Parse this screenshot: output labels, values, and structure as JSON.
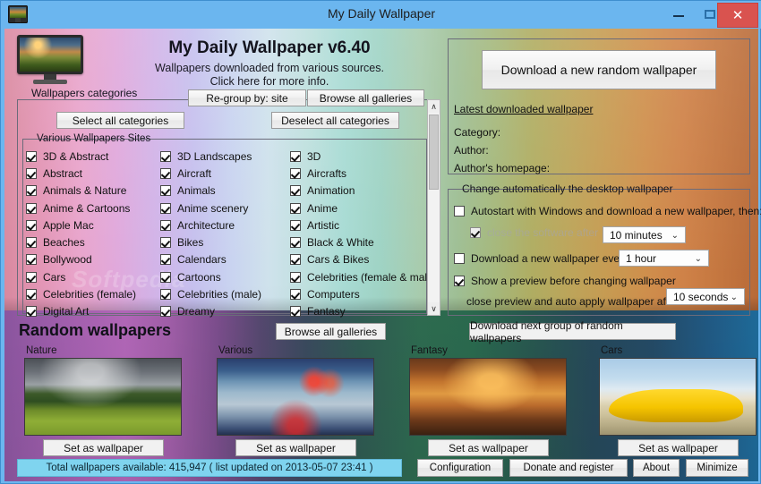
{
  "window": {
    "title": "My Daily Wallpaper",
    "icon": "monitor-icon",
    "minimize_label": "–",
    "maximize_label": "☐",
    "close_label": "✕"
  },
  "header": {
    "app_title": "My Daily Wallpaper v6.40",
    "subtitle_line1": "Wallpapers downloaded from various sources.",
    "subtitle_line2": "Click here for more info.",
    "monitor_icon": "monitor-icon"
  },
  "categories_panel": {
    "group_title": "Wallpapers categories",
    "regroup_button": "Re-group by: site",
    "browse_all_button": "Browse all galleries",
    "select_all_button": "Select all categories",
    "deselect_all_button": "Deselect all categories",
    "sites_group_title": "Various Wallpapers Sites",
    "columns": [
      {
        "items": [
          {
            "label": "3D & Abstract",
            "checked": true
          },
          {
            "label": "Abstract",
            "checked": true
          },
          {
            "label": "Animals & Nature",
            "checked": true
          },
          {
            "label": "Anime & Cartoons",
            "checked": true
          },
          {
            "label": "Apple Mac",
            "checked": true
          },
          {
            "label": "Beaches",
            "checked": true
          },
          {
            "label": "Bollywood",
            "checked": true
          },
          {
            "label": "Cars",
            "checked": true
          },
          {
            "label": "Celebrities (female)",
            "checked": true
          },
          {
            "label": "Digital Art",
            "checked": true
          }
        ]
      },
      {
        "items": [
          {
            "label": "3D Landscapes",
            "checked": true
          },
          {
            "label": "Aircraft",
            "checked": true
          },
          {
            "label": "Animals",
            "checked": true
          },
          {
            "label": "Anime scenery",
            "checked": true
          },
          {
            "label": "Architecture",
            "checked": true
          },
          {
            "label": "Bikes",
            "checked": true
          },
          {
            "label": "Calendars",
            "checked": true
          },
          {
            "label": "Cartoons",
            "checked": true
          },
          {
            "label": "Celebrities (male)",
            "checked": true
          },
          {
            "label": "Dreamy",
            "checked": true
          }
        ]
      },
      {
        "items": [
          {
            "label": "3D",
            "checked": true
          },
          {
            "label": "Aircrafts",
            "checked": true
          },
          {
            "label": "Animation",
            "checked": true
          },
          {
            "label": "Anime",
            "checked": true
          },
          {
            "label": "Artistic",
            "checked": true
          },
          {
            "label": "Black & White",
            "checked": true
          },
          {
            "label": "Cars & Bikes",
            "checked": true
          },
          {
            "label": "Celebrities (female & male)",
            "checked": true
          },
          {
            "label": "Computers",
            "checked": true
          },
          {
            "label": "Fantasy",
            "checked": true
          }
        ]
      }
    ],
    "scrollbar": {
      "up_arrow": "∧",
      "down_arrow": "∨"
    }
  },
  "download_panel": {
    "download_button": "Download a new random wallpaper",
    "latest_link": "Latest downloaded wallpaper",
    "category_label": "Category:",
    "author_label": "Author:",
    "author_homepage_label": "Author's homepage:"
  },
  "auto_panel": {
    "group_title": "Change automatically the desktop wallpaper",
    "autostart_label": "Autostart with Windows and download a new wallpaper, then:",
    "autostart_checked": false,
    "close_after_label": "close the software after",
    "close_after_checked": true,
    "close_after_disabled": true,
    "close_after_value": "10 minutes",
    "download_every_label": "Download a new wallpaper every",
    "download_every_checked": false,
    "download_every_value": "1 hour",
    "preview_label": "Show a preview before changing wallpaper",
    "preview_checked": true,
    "preview_sub_label": "close preview and auto apply wallpaper after",
    "preview_value": "10 seconds",
    "chevron": "⌄"
  },
  "random_panel": {
    "title": "Random wallpapers",
    "browse_button": "Browse all galleries",
    "download_next_button": "Download next group of random wallpapers",
    "set_wallpaper_label": "Set as wallpaper",
    "thumbnails": [
      {
        "label": "Nature",
        "art": "nature"
      },
      {
        "label": "Various",
        "art": "various"
      },
      {
        "label": "Fantasy",
        "art": "fantasy"
      },
      {
        "label": "Cars",
        "art": "cars"
      }
    ]
  },
  "statusbar": {
    "text": "Total wallpapers available: 415,947 ( list updated on 2013-05-07 23:41 )",
    "configuration_button": "Configuration",
    "donate_button": "Donate and register",
    "about_button": "About",
    "minimize_button": "Minimize"
  },
  "watermark": "Softpedia",
  "colors": {
    "titlebar": "#6bb6ef",
    "close_button": "#d9534f",
    "statusbar": "#7fd4ef",
    "button_face": "#efefef"
  }
}
